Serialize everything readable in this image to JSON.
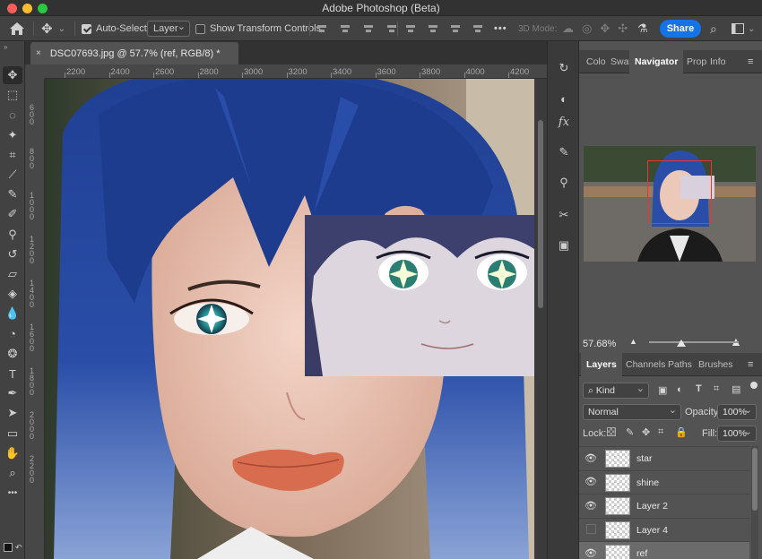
{
  "window": {
    "title": "Adobe Photoshop (Beta)",
    "traffic_colors": [
      "#ff5f57",
      "#febc2e",
      "#28c840"
    ]
  },
  "options_bar": {
    "auto_select_label": "Auto-Select:",
    "auto_select_checked": true,
    "auto_select_value": "Layer",
    "show_transform_label": "Show Transform Controls",
    "show_transform_checked": false,
    "more_label": "•••",
    "mode_3d_label": "3D Mode:",
    "share_label": "Share"
  },
  "document": {
    "tab_title": "DSC07693.jpg @ 57.7% (ref, RGB/8) *",
    "close_label": "×",
    "ruler_h": [
      "2200",
      "2400",
      "2600",
      "2800",
      "3000",
      "3200",
      "3400",
      "3600",
      "3800",
      "4000",
      "4200"
    ],
    "ruler_v": [
      "600",
      "800",
      "1000",
      "1200",
      "1400",
      "1600",
      "1800",
      "2000",
      "2200"
    ]
  },
  "toolbar": {
    "tools": [
      {
        "name": "move-tool-icon",
        "glyph": "✥",
        "active": true
      },
      {
        "name": "marquee-tool-icon",
        "glyph": "⬚",
        "active": false
      },
      {
        "name": "lasso-tool-icon",
        "glyph": "◌",
        "active": false
      },
      {
        "name": "magic-wand-tool-icon",
        "glyph": "✦",
        "active": false
      },
      {
        "name": "crop-tool-icon",
        "glyph": "⌗",
        "active": false
      },
      {
        "name": "eyedropper-tool-icon",
        "glyph": "⟋",
        "active": false
      },
      {
        "name": "healing-brush-tool-icon",
        "glyph": "✎",
        "active": false
      },
      {
        "name": "brush-tool-icon",
        "glyph": "✐",
        "active": false
      },
      {
        "name": "clone-stamp-tool-icon",
        "glyph": "⚲",
        "active": false
      },
      {
        "name": "history-brush-tool-icon",
        "glyph": "↺",
        "active": false
      },
      {
        "name": "eraser-tool-icon",
        "glyph": "▱",
        "active": false
      },
      {
        "name": "paint-bucket-tool-icon",
        "glyph": "◈",
        "active": false
      },
      {
        "name": "blur-tool-icon",
        "glyph": "💧",
        "active": false
      },
      {
        "name": "dodge-tool-icon",
        "glyph": "◔",
        "active": false
      },
      {
        "name": "sponge-tool-icon",
        "glyph": "❂",
        "active": false
      },
      {
        "name": "type-tool-icon",
        "glyph": "T",
        "active": false
      },
      {
        "name": "pen-tool-icon",
        "glyph": "✒",
        "active": false
      },
      {
        "name": "path-selection-tool-icon",
        "glyph": "➤",
        "active": false
      },
      {
        "name": "rectangle-tool-icon",
        "glyph": "▭",
        "active": false
      },
      {
        "name": "hand-tool-icon",
        "glyph": "✋",
        "active": false
      },
      {
        "name": "zoom-tool-icon",
        "glyph": "⌕",
        "active": false
      },
      {
        "name": "more-tools-icon",
        "glyph": "•••",
        "active": false
      }
    ]
  },
  "panel_top": {
    "tabs": [
      {
        "label": "Colo",
        "active": false
      },
      {
        "label": "Swat",
        "active": false
      },
      {
        "label": "Navigator",
        "active": true
      },
      {
        "label": "Prop",
        "active": false
      },
      {
        "label": "Info",
        "active": false
      }
    ],
    "zoom": "57.68%"
  },
  "layers_panel": {
    "tabs": [
      {
        "label": "Layers",
        "active": true
      },
      {
        "label": "Channels",
        "active": false
      },
      {
        "label": "Paths",
        "active": false
      },
      {
        "label": "Brushes",
        "active": false
      }
    ],
    "filter_kind": "Kind",
    "blend_mode": "Normal",
    "opacity_label": "Opacity:",
    "opacity_value": "100%",
    "lock_label": "Lock:",
    "fill_label": "Fill:",
    "fill_value": "100%",
    "layers": [
      {
        "name": "star",
        "visible": true,
        "selected": false
      },
      {
        "name": "shine",
        "visible": true,
        "selected": false
      },
      {
        "name": "Layer 2",
        "visible": true,
        "selected": false
      },
      {
        "name": "Layer 4",
        "visible": false,
        "selected": false
      },
      {
        "name": "ref",
        "visible": true,
        "selected": true
      }
    ]
  }
}
